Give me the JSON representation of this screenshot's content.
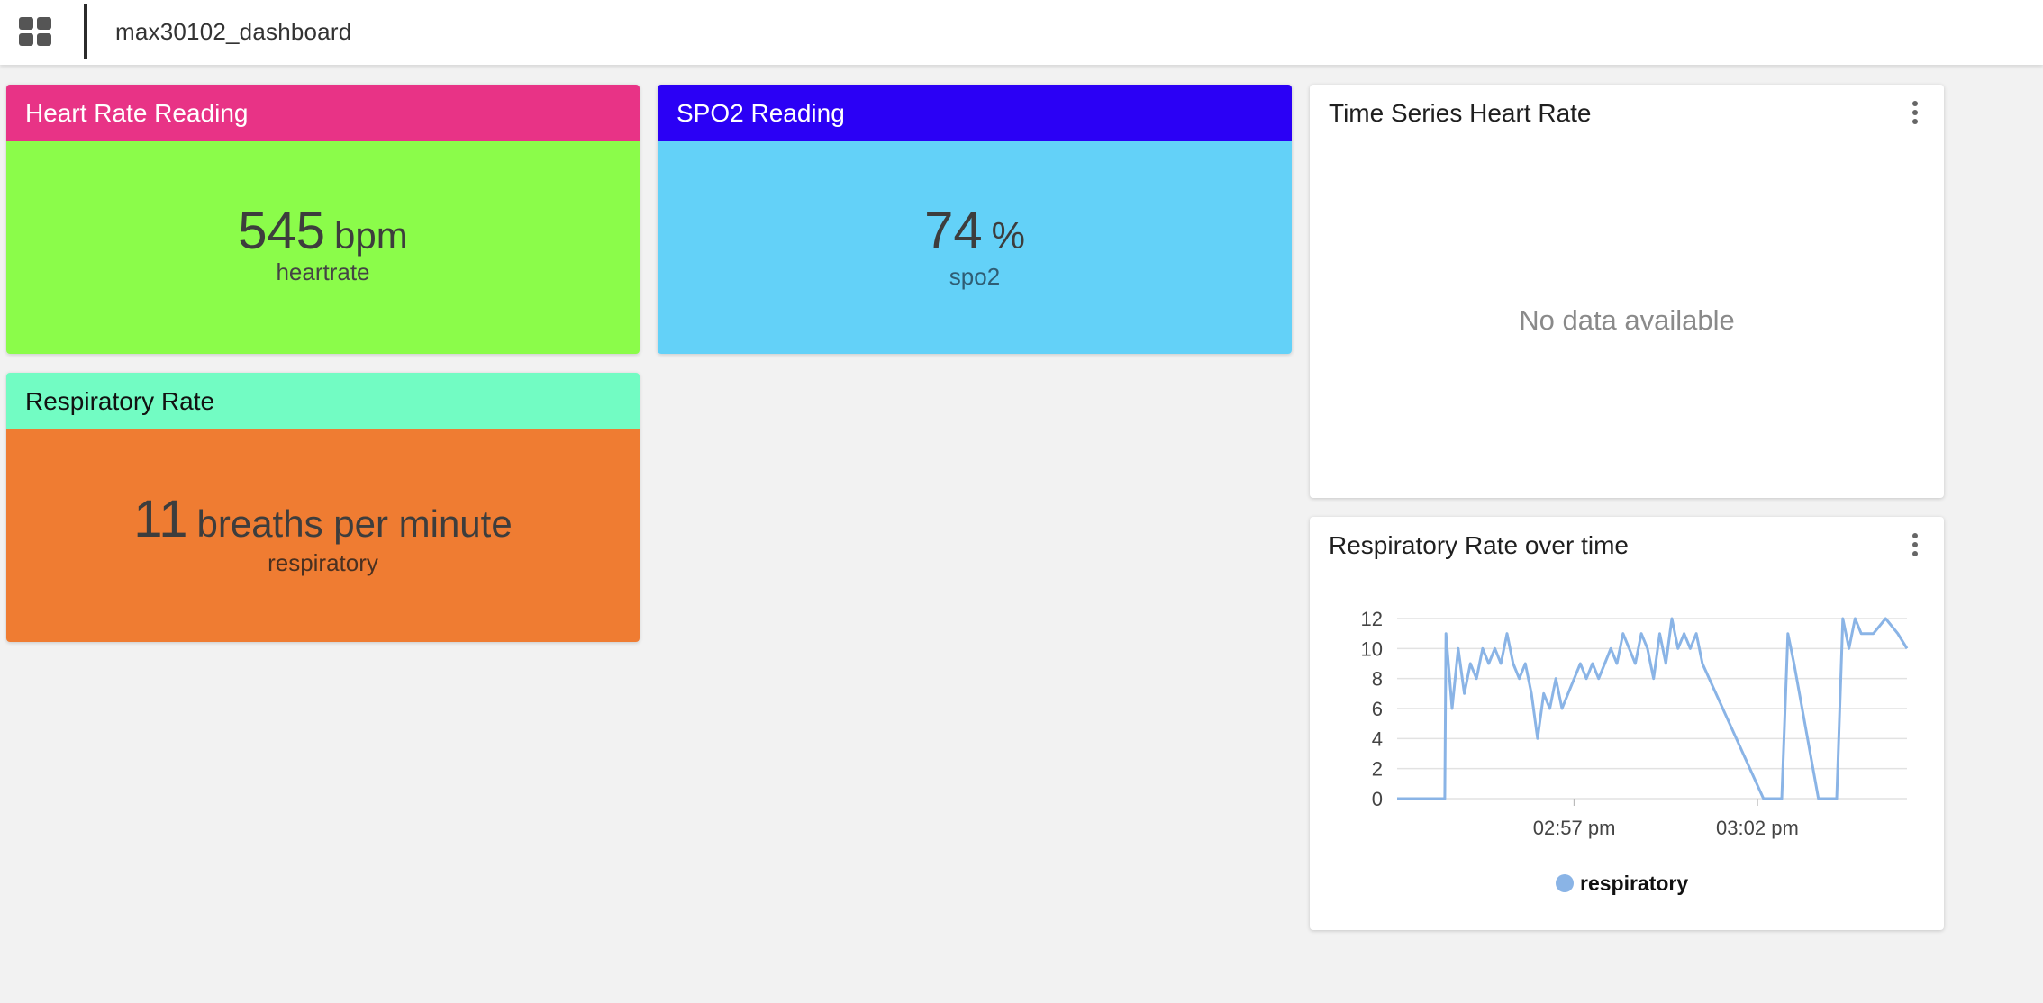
{
  "header": {
    "title": "max30102_dashboard",
    "menu_icon": "grid-icon"
  },
  "heart_rate_card": {
    "title": "Heart Rate Reading",
    "value": "545",
    "unit": "bpm",
    "label": "heartrate",
    "header_color": "#e83386",
    "body_color": "#8bfc4a"
  },
  "spo2_card": {
    "title": "SPO2 Reading",
    "value": "74",
    "unit": "%",
    "label": "spo2",
    "header_color": "#2b00f5",
    "body_color": "#63d1f8"
  },
  "respiratory_card": {
    "title": "Respiratory Rate",
    "value": "11",
    "unit": "breaths per minute",
    "label": "respiratory",
    "header_color": "#72fcc3",
    "body_color": "#ef7c32"
  },
  "time_series_heart_rate": {
    "title": "Time Series Heart Rate",
    "empty_message": "No data available",
    "menu_icon": "kebab-menu-icon"
  },
  "respiratory_over_time": {
    "title": "Respiratory Rate over time",
    "menu_icon": "kebab-menu-icon",
    "legend_label": "respiratory",
    "series_color": "#8ab4e6"
  },
  "chart_data": {
    "type": "line",
    "title": "Respiratory Rate over time",
    "xlabel": "",
    "ylabel": "",
    "ylim": [
      0,
      12
    ],
    "xlim": [
      "02:52:10 pm",
      "03:06:05 pm"
    ],
    "y_ticks": [
      0,
      2,
      4,
      6,
      8,
      10,
      12
    ],
    "x_ticks": [
      "02:57 pm",
      "03:02 pm"
    ],
    "grid": true,
    "legend": "bottom-center",
    "series": [
      {
        "name": "respiratory",
        "points": [
          [
            "02:52:10 pm",
            0
          ],
          [
            "02:53:28 pm",
            0
          ],
          [
            "02:53:30 pm",
            11
          ],
          [
            "02:53:40 pm",
            6
          ],
          [
            "02:53:50 pm",
            10
          ],
          [
            "02:54:00 pm",
            7
          ],
          [
            "02:54:10 pm",
            9
          ],
          [
            "02:54:20 pm",
            8
          ],
          [
            "02:54:30 pm",
            10
          ],
          [
            "02:54:40 pm",
            9
          ],
          [
            "02:54:50 pm",
            10
          ],
          [
            "02:55:00 pm",
            9
          ],
          [
            "02:55:10 pm",
            11
          ],
          [
            "02:55:20 pm",
            9
          ],
          [
            "02:55:30 pm",
            8
          ],
          [
            "02:55:40 pm",
            9
          ],
          [
            "02:55:50 pm",
            7
          ],
          [
            "02:56:00 pm",
            4
          ],
          [
            "02:56:10 pm",
            7
          ],
          [
            "02:56:20 pm",
            6
          ],
          [
            "02:56:30 pm",
            8
          ],
          [
            "02:56:40 pm",
            6
          ],
          [
            "02:56:50 pm",
            7
          ],
          [
            "02:57:00 pm",
            8
          ],
          [
            "02:57:10 pm",
            9
          ],
          [
            "02:57:20 pm",
            8
          ],
          [
            "02:57:30 pm",
            9
          ],
          [
            "02:57:40 pm",
            8
          ],
          [
            "02:57:50 pm",
            9
          ],
          [
            "02:58:00 pm",
            10
          ],
          [
            "02:58:10 pm",
            9
          ],
          [
            "02:58:20 pm",
            11
          ],
          [
            "02:58:30 pm",
            10
          ],
          [
            "02:58:40 pm",
            9
          ],
          [
            "02:58:50 pm",
            11
          ],
          [
            "02:59:00 pm",
            10
          ],
          [
            "02:59:10 pm",
            8
          ],
          [
            "02:59:20 pm",
            11
          ],
          [
            "02:59:30 pm",
            9
          ],
          [
            "02:59:40 pm",
            12
          ],
          [
            "02:59:50 pm",
            10
          ],
          [
            "03:00:00 pm",
            11
          ],
          [
            "03:00:10 pm",
            10
          ],
          [
            "03:00:20 pm",
            11
          ],
          [
            "03:00:30 pm",
            9
          ],
          [
            "03:02:10 pm",
            0
          ],
          [
            "03:02:40 pm",
            0
          ],
          [
            "03:02:50 pm",
            11
          ],
          [
            "03:03:00 pm",
            9
          ],
          [
            "03:03:40 pm",
            0
          ],
          [
            "03:04:10 pm",
            0
          ],
          [
            "03:04:20 pm",
            12
          ],
          [
            "03:04:30 pm",
            10
          ],
          [
            "03:04:40 pm",
            12
          ],
          [
            "03:04:50 pm",
            11
          ],
          [
            "03:05:10 pm",
            11
          ],
          [
            "03:05:30 pm",
            12
          ],
          [
            "03:05:50 pm",
            11
          ],
          [
            "03:06:05 pm",
            10
          ]
        ]
      }
    ]
  }
}
